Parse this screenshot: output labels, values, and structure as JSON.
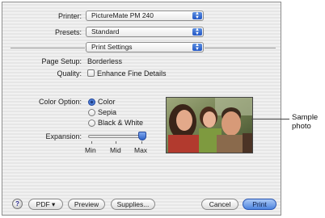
{
  "printer": {
    "label": "Printer:",
    "value": "PictureMate PM 240"
  },
  "presets": {
    "label": "Presets:",
    "value": "Standard"
  },
  "panel": {
    "value": "Print Settings"
  },
  "page_setup": {
    "label": "Page Setup:",
    "value": "Borderless"
  },
  "quality": {
    "label": "Quality:",
    "option": "Enhance Fine Details",
    "checked": false
  },
  "color_option": {
    "label": "Color Option:",
    "options": [
      "Color",
      "Sepia",
      "Black & White"
    ],
    "selected": "Color"
  },
  "expansion": {
    "label": "Expansion:",
    "ticks": [
      "Min",
      "Mid",
      "Max"
    ],
    "level": "Max"
  },
  "buttons": {
    "help": "?",
    "pdf": "PDF ▾",
    "preview": "Preview",
    "supplies": "Supplies...",
    "cancel": "Cancel",
    "print": "Print"
  },
  "callout": {
    "line1": "Sample",
    "line2": "photo"
  },
  "colors": {
    "accent": "#3a6fd6",
    "dialog_bg": "#ececec"
  }
}
